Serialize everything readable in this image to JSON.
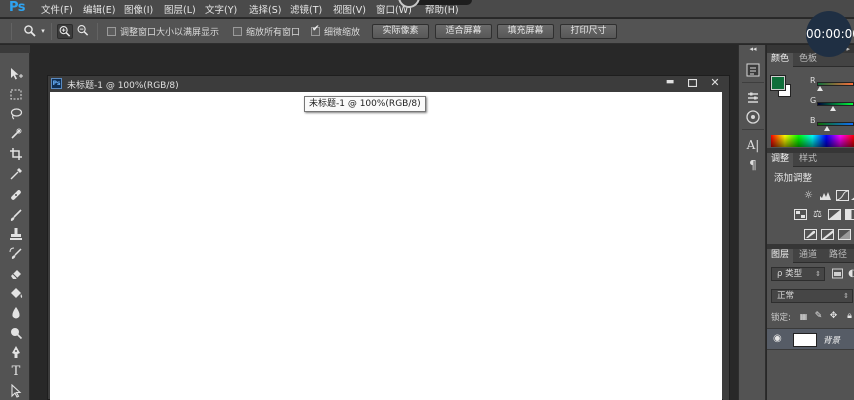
{
  "app": {
    "logo": "Ps"
  },
  "menu": {
    "items": [
      "文件(F)",
      "编辑(E)",
      "图像(I)",
      "图层(L)",
      "文字(Y)",
      "选择(S)",
      "滤镜(T)",
      "视图(V)",
      "窗口(W)",
      "帮助(H)"
    ]
  },
  "options": {
    "tool_icon": "zoom-icon",
    "checkboxes": [
      {
        "label": "调整窗口大小以满屏显示",
        "checked": false
      },
      {
        "label": "缩放所有窗口",
        "checked": false
      },
      {
        "label": "细微缩放",
        "checked": true
      }
    ],
    "buttons": [
      "实际像素",
      "适合屏幕",
      "填充屏幕",
      "打印尺寸"
    ]
  },
  "timer": {
    "text": "00:00:00"
  },
  "document": {
    "title": "未标题-1 @ 100%(RGB/8)",
    "icon_text": "Ps",
    "tooltip": "未标题-1 @ 100%(RGB/8)"
  },
  "panels": {
    "color": {
      "tabs": [
        "颜色",
        "色板"
      ],
      "channels": [
        "R",
        "G",
        "B"
      ],
      "foreground": "#0f6e3a",
      "background": "#ffffff"
    },
    "adjustments": {
      "tabs": [
        "调整",
        "样式"
      ],
      "title": "添加调整"
    },
    "layers": {
      "tabs": [
        "图层",
        "通道",
        "路径"
      ],
      "filter_label": "ρ 类型",
      "blend_mode": "正常",
      "lock_label": "锁定:",
      "layer_name": "背景"
    }
  },
  "colors": {
    "menubar": "#4a4a4a",
    "panel": "#535353",
    "workspace": "#282828",
    "accent": "#2fa3f0"
  }
}
